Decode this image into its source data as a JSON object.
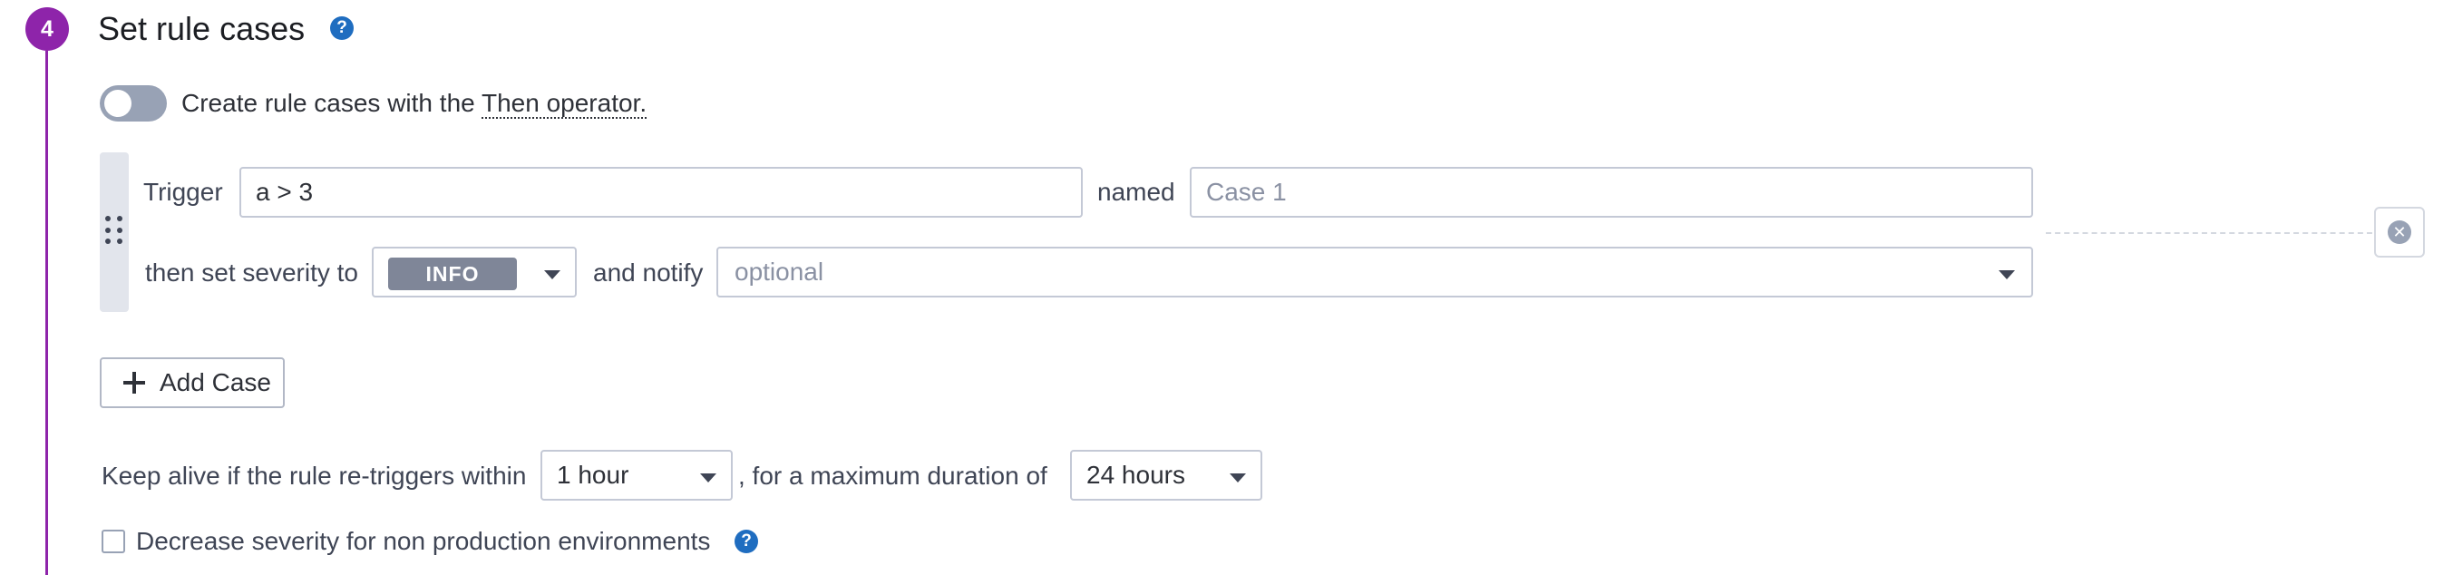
{
  "step": {
    "number": "4",
    "title": "Set rule cases",
    "help_icon": "question-circle-icon"
  },
  "toggle": {
    "on": false,
    "text": "Create rule cases with the ",
    "link_text": "Then operator."
  },
  "case": {
    "trigger_label": "Trigger",
    "trigger_value": "a > 3",
    "named_label": "named",
    "name_placeholder": "Case 1",
    "severity_label": "then set severity to",
    "severity_value": "INFO",
    "notify_label": "and notify",
    "notify_placeholder": "optional",
    "drag_icon": "drag-handle-icon",
    "remove_icon": "close-circle-icon"
  },
  "add_case_label": "Add Case",
  "keep_alive": {
    "label": "Keep alive if the rule re-triggers within",
    "within_value": "1 hour",
    "separator": ", for a maximum duration of",
    "max_value": "24 hours"
  },
  "decrease": {
    "label": "Decrease severity for non production environments",
    "checked": false
  },
  "colors": {
    "step_accent": "#8e24aa",
    "help_icon": "#1f6dc0",
    "severity_info_badge": "#7f8698"
  }
}
